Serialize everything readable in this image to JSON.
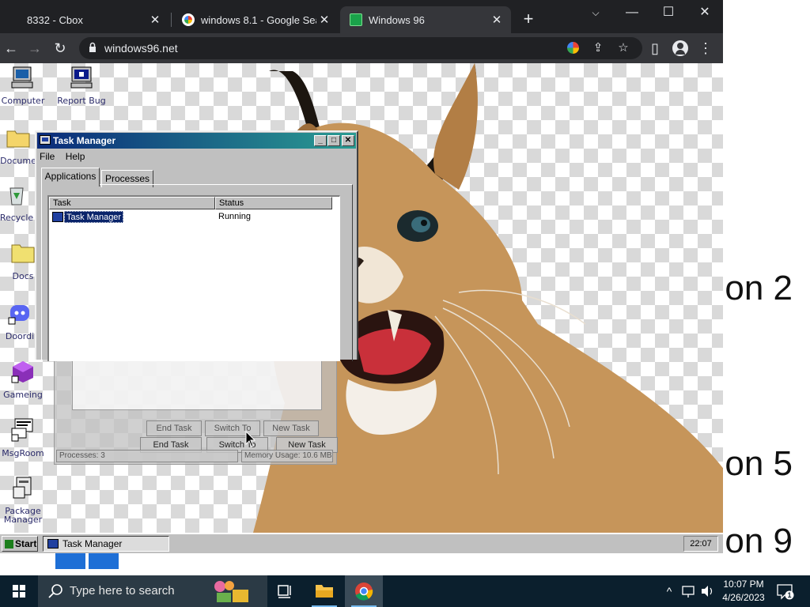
{
  "browser": {
    "tabs": [
      {
        "label": "8332 - Cbox",
        "active": false
      },
      {
        "label": "windows 8.1 - Google Search",
        "active": false
      },
      {
        "label": "Windows 96",
        "active": true
      }
    ],
    "url": "windows96.net",
    "new_tab_symbol": "+"
  },
  "bleed_text": [
    "on 2",
    "on 5",
    "on 9"
  ],
  "desktop_icons": [
    {
      "label": "Computer"
    },
    {
      "label": "Report Bug"
    },
    {
      "label": "Docume"
    },
    {
      "label": "Recycle"
    },
    {
      "label": "Docs"
    },
    {
      "label": "Doordi"
    },
    {
      "label": "Gameing"
    },
    {
      "label": "MsgRoom"
    },
    {
      "label": "Package Manager"
    }
  ],
  "task_manager": {
    "title": "Task Manager",
    "menu": [
      "File",
      "Help"
    ],
    "tabs": [
      "Applications",
      "Processes"
    ],
    "columns": [
      "Task",
      "Status"
    ],
    "rows": [
      {
        "task": "Task Manager",
        "status": "Running"
      }
    ],
    "ghost": {
      "buttons": [
        "End Task",
        "Switch To",
        "New Task"
      ],
      "buttons_lower": [
        "End Task",
        "Switch To",
        "New Task"
      ],
      "status_processes": "Processes: 3",
      "status_memory": "Memory Usage: 10.6 MB"
    }
  },
  "w96_taskbar": {
    "start_label": "Start",
    "task_label": "Task Manager",
    "clock": "22:07"
  },
  "win_taskbar": {
    "search_placeholder": "Type here to search",
    "time": "10:07 PM",
    "date": "4/26/2023",
    "notification_count": "1"
  }
}
